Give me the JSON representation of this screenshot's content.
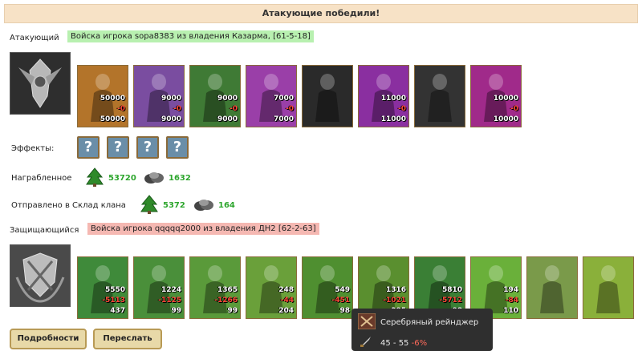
{
  "banner": "Атакующие победили!",
  "attacker": {
    "label": "Атакующий",
    "army": "Войска игрока sopa8383 из владения Казарма, [61-5-18]",
    "units": [
      {
        "top": "50000",
        "mid": "-0",
        "bot": "50000",
        "color": "#b3742a"
      },
      {
        "top": "9000",
        "mid": "-0",
        "bot": "9000",
        "color": "#7a4da0"
      },
      {
        "top": "9000",
        "mid": "-0",
        "bot": "9000",
        "color": "#3f7a35"
      },
      {
        "top": "7000",
        "mid": "-0",
        "bot": "7000",
        "color": "#9a3fa8"
      },
      {
        "top": "",
        "mid": "",
        "bot": "",
        "color": "#2a2a2a"
      },
      {
        "top": "11000",
        "mid": "-0",
        "bot": "11000",
        "color": "#8a2fa0"
      },
      {
        "top": "",
        "mid": "",
        "bot": "",
        "color": "#333333"
      },
      {
        "top": "10000",
        "mid": "-0",
        "bot": "10000",
        "color": "#a02a8a"
      }
    ]
  },
  "effects": {
    "label": "Эффекты:",
    "items": [
      "?",
      "?",
      "?",
      "?"
    ]
  },
  "loot": {
    "label": "Награбленное",
    "wood": "53720",
    "ore": "1632"
  },
  "clan": {
    "label": "Отправлено в Склад клана",
    "wood": "5372",
    "ore": "164"
  },
  "defender": {
    "label": "Защищающийся",
    "army": "Войска игрока qqqqq2000 из владения ДН2 [62-2-63]",
    "units": [
      {
        "top": "5550",
        "mid": "-5113",
        "bot": "437",
        "color": "#3f8a3a"
      },
      {
        "top": "1224",
        "mid": "-1125",
        "bot": "99",
        "color": "#4a8f3a"
      },
      {
        "top": "1365",
        "mid": "-1266",
        "bot": "99",
        "color": "#5a9a3a"
      },
      {
        "top": "248",
        "mid": "-44",
        "bot": "204",
        "color": "#6aa03a"
      },
      {
        "top": "549",
        "mid": "-451",
        "bot": "98",
        "color": "#4f8f30"
      },
      {
        "top": "1316",
        "mid": "-1021",
        "bot": "295",
        "color": "#5a8f2f"
      },
      {
        "top": "5810",
        "mid": "-5712",
        "bot": "98",
        "color": "#3a7f35"
      },
      {
        "top": "194",
        "mid": "-84",
        "bot": "110",
        "color": "#6ab03a"
      },
      {
        "top": "",
        "mid": "",
        "bot": "",
        "color": "#7a9a4a"
      },
      {
        "top": "",
        "mid": "",
        "bot": "",
        "color": "#8ab03a"
      }
    ]
  },
  "buttons": {
    "details": "Подробности",
    "forward": "Переслать"
  },
  "tooltip": {
    "name": "Серебряный рейнджер",
    "damage": "45 - 55",
    "bonus": "-6%"
  }
}
